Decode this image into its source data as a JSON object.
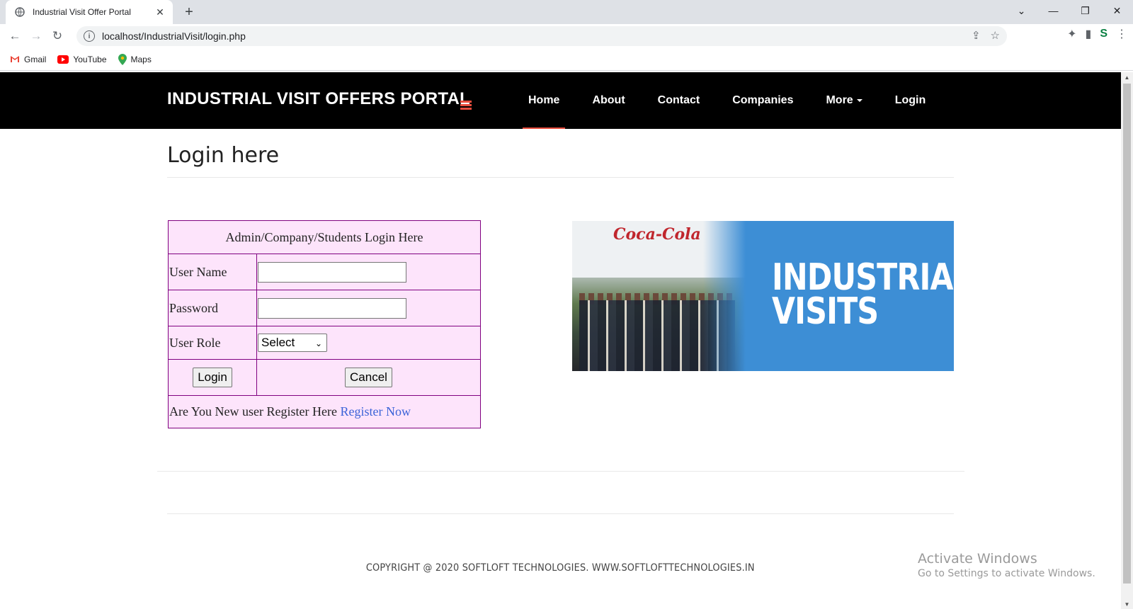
{
  "browser": {
    "tab_title": "Industrial Visit Offer Portal",
    "new_tab": "+",
    "url": "localhost/IndustrialVisit/login.php",
    "bookmarks": [
      {
        "label": "Gmail",
        "icon": "gmail-icon"
      },
      {
        "label": "YouTube",
        "icon": "youtube-icon"
      },
      {
        "label": "Maps",
        "icon": "maps-icon"
      }
    ]
  },
  "header": {
    "brand": "INDUSTRIAL VISIT OFFERS PORTAL",
    "menu": [
      {
        "label": "Home",
        "active": true
      },
      {
        "label": "About"
      },
      {
        "label": "Contact"
      },
      {
        "label": "Companies"
      },
      {
        "label": "More"
      },
      {
        "label": "Login"
      }
    ],
    "accent_color": "#e74c3c"
  },
  "main": {
    "heading": "Login here",
    "form": {
      "title": "Admin/Company/Students Login Here",
      "username_label": "User Name",
      "username_value": "",
      "password_label": "Password",
      "password_value": "",
      "role_label": "User Role",
      "role_selected": "Select",
      "login_button": "Login",
      "cancel_button": "Cancel",
      "register_prompt": "Are You New user Register Here",
      "register_link": "Register Now"
    },
    "banner": {
      "line1": "INDUSTRIAL",
      "line2": "VISITS",
      "logo_text": "Coca-Cola"
    }
  },
  "footer": {
    "copyright": "COPYRIGHT @ 2020 SOFTLOFT TECHNOLOGIES. WWW.SOFTLOFTTECHNOLOGIES.IN"
  },
  "watermark": {
    "line1": "Activate Windows",
    "line2": "Go to Settings to activate Windows."
  }
}
